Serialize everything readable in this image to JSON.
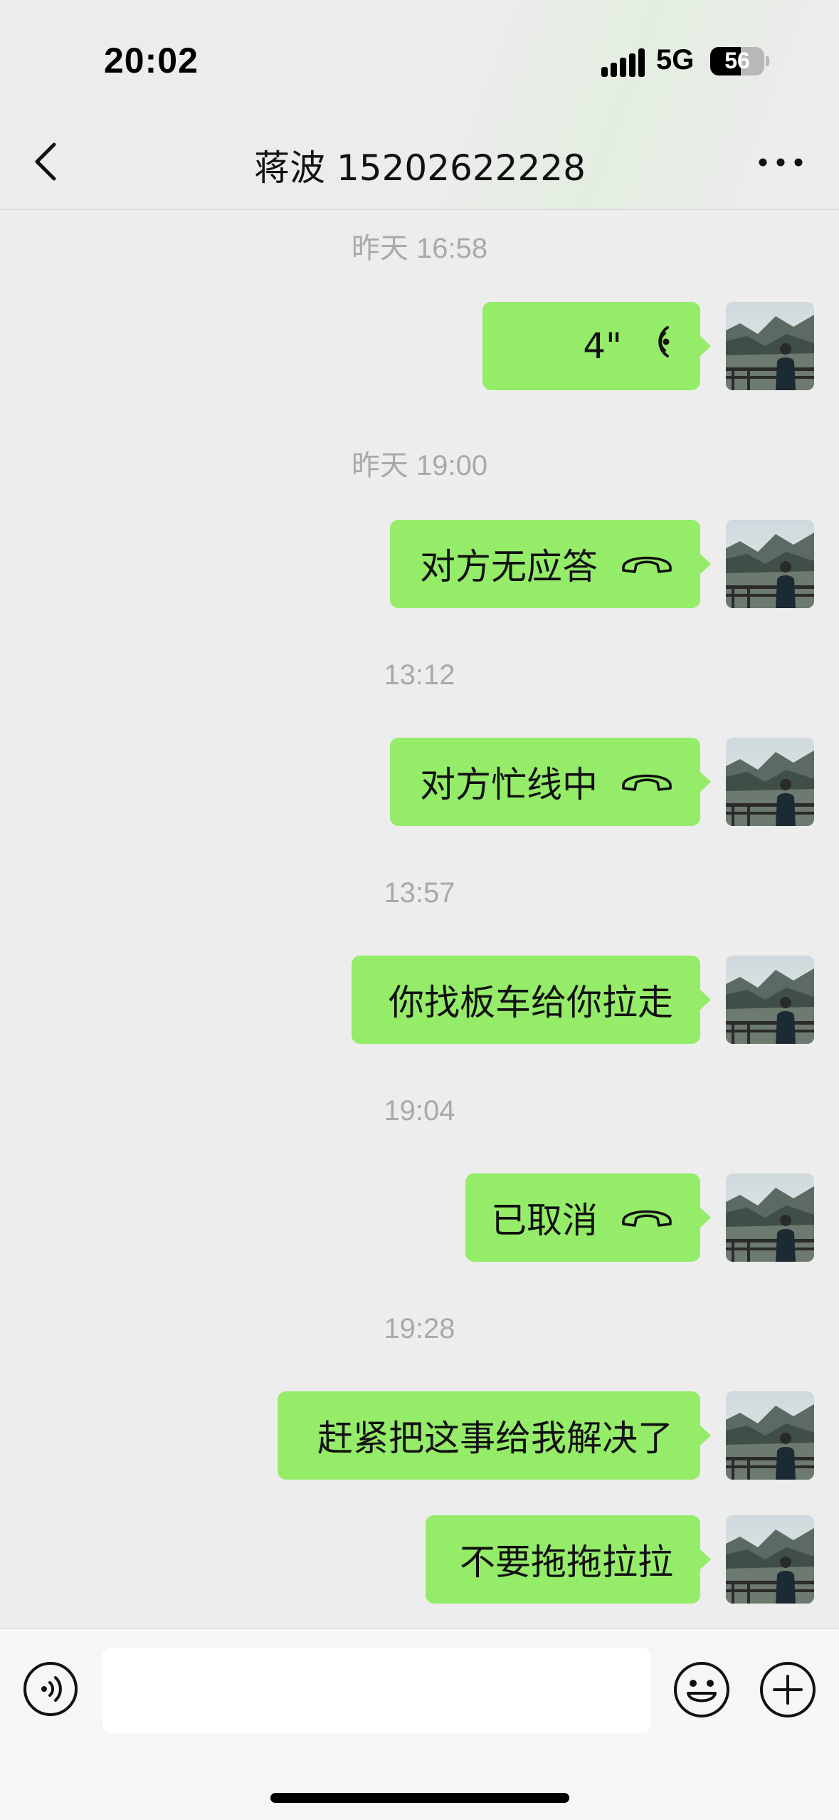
{
  "status_bar": {
    "time": "20:02",
    "network": "5G",
    "battery_level": "56",
    "battery_fraction": 0.56
  },
  "header": {
    "title": "蒋波 15202622228"
  },
  "messages": [
    {
      "kind": "timestamp",
      "text": "昨天 16:58"
    },
    {
      "kind": "voice",
      "text": "4\"",
      "icon": "voice-wave-icon"
    },
    {
      "kind": "timestamp",
      "text": "昨天 19:00"
    },
    {
      "kind": "call",
      "text": "对方无应答",
      "icon": "hangup-phone-icon"
    },
    {
      "kind": "timestamp",
      "text": "13:12"
    },
    {
      "kind": "call",
      "text": "对方忙线中",
      "icon": "hangup-phone-icon"
    },
    {
      "kind": "timestamp",
      "text": "13:57"
    },
    {
      "kind": "text",
      "text": "你找板车给你拉走"
    },
    {
      "kind": "timestamp",
      "text": "19:04"
    },
    {
      "kind": "call",
      "text": "已取消",
      "icon": "hangup-phone-icon"
    },
    {
      "kind": "timestamp",
      "text": "19:28"
    },
    {
      "kind": "text",
      "text": "赶紧把这事给我解决了"
    },
    {
      "kind": "text",
      "text": "不要拖拖拉拉"
    }
  ],
  "input_bar": {
    "voice_icon": "voice-mode-icon",
    "text_value": "",
    "emoji_icon": "emoji-icon",
    "plus_icon": "plus-icon"
  },
  "colors": {
    "chat_background": "#ededed",
    "bubble_green": "#95ec69",
    "timestamp_gray": "#a9a9a9",
    "input_bar_bg": "#f6f6f6"
  }
}
